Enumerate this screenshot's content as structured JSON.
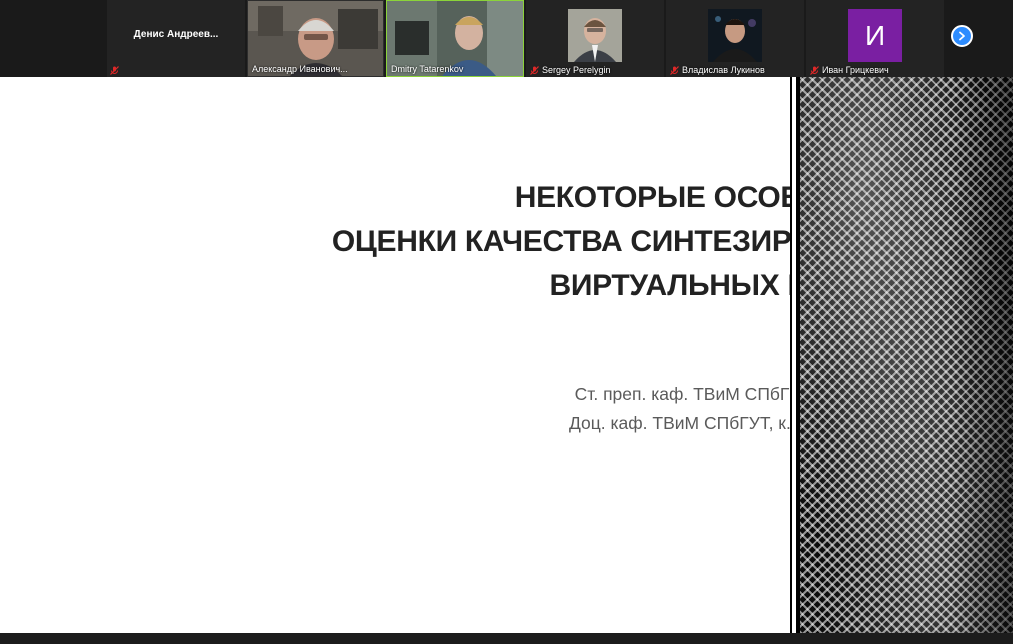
{
  "participants": [
    {
      "name": "Денис Андреев...",
      "muted": true,
      "type": "name-only"
    },
    {
      "name": "Александр Иванович...",
      "muted": false,
      "type": "video"
    },
    {
      "name": "Dmitry Tatarenkov",
      "muted": false,
      "type": "video",
      "active": true
    },
    {
      "name": "Sergey Perelygin",
      "muted": true,
      "type": "avatar"
    },
    {
      "name": "Владислав Лукинов",
      "muted": true,
      "type": "avatar"
    },
    {
      "name": "Иван Грицкевич",
      "muted": true,
      "type": "letter",
      "letter": "И"
    }
  ],
  "colors": {
    "accent_blue": "#2d8cff",
    "mute_red": "#e02828",
    "active_speaker": "#8bd33a",
    "letter_avatar": "#7a1fa2"
  },
  "slide": {
    "title_lines": [
      "НЕКОТОРЫЕ ОСОБЕННОСТИ",
      "ОЦЕНКИ КАЧЕСТВА СИНТЕЗИРОВАННЫХ",
      "ВИРТУАЛЬНЫХ РАКУРСОВ"
    ],
    "author_lines": [
      "Ст. преп. каф. ТВиМ СПбГУТ Татаренков Д.А.",
      "Доц. каф. ТВиМ СПбГУТ, к.т.н., Бучатский А.Н."
    ]
  }
}
